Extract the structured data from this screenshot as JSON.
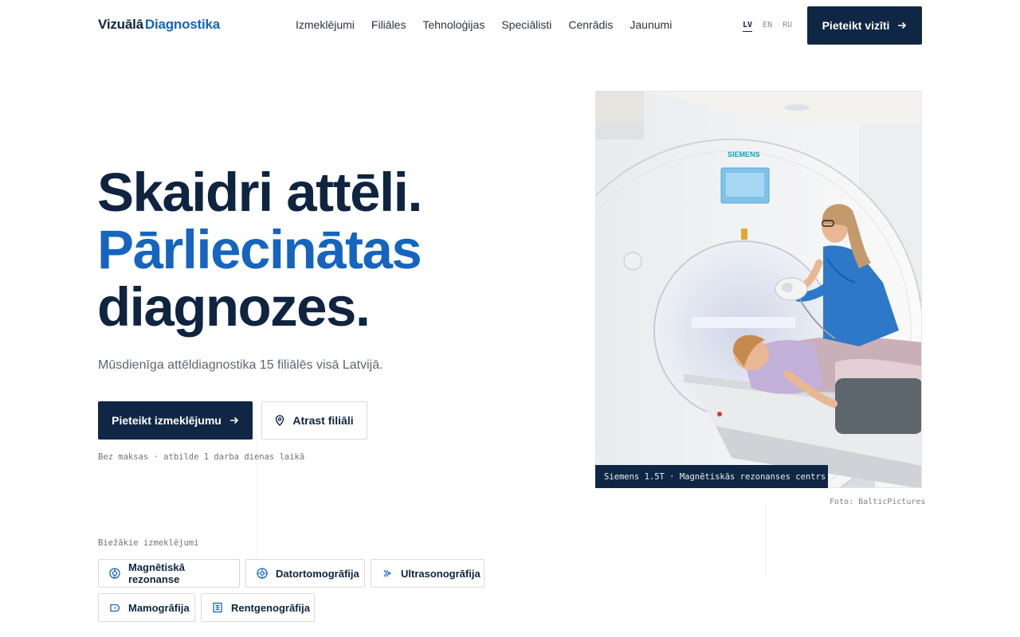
{
  "brand": {
    "part1": "Vizuālā",
    "part2": "Diagnostika"
  },
  "nav": [
    "Izmeklējumi",
    "Filiāles",
    "Tehnoloģijas",
    "Speciālisti",
    "Cenrādis",
    "Jaunumi"
  ],
  "languages": {
    "lv": "LV",
    "en": "EN",
    "ru": "RU"
  },
  "header_cta": "Pieteikt vizīti",
  "hero": {
    "line1": "Skaidri attēli.",
    "line2": "Pārliecinātas",
    "line3": "diagnozes.",
    "lead": "Mūsdienīga attēldiagnostika 15 filiālēs visā Latvijā.",
    "primary_button": "Pieteikt izmeklējumu",
    "secondary_button": "Atrast filiāli",
    "note": "Bez maksas · atbilde 1 darba dienas laikā"
  },
  "common_exams": {
    "label": "Biežākie izmeklējumi",
    "items": [
      "Magnētiskā rezonanse",
      "Datortomogrāfija",
      "Ultrasonogrāfija",
      "Mamogrāfija",
      "Rentgenogrāfija"
    ]
  },
  "photo": {
    "scanner_brand": "SIEMENS",
    "caption": "Siemens 1.5T · Magnētiskās rezonanses centrs",
    "credit": "Foto: BalticPictures"
  },
  "colors": {
    "navy": "#0f2744",
    "accent": "#1565c0",
    "muted": "#5d6673"
  }
}
